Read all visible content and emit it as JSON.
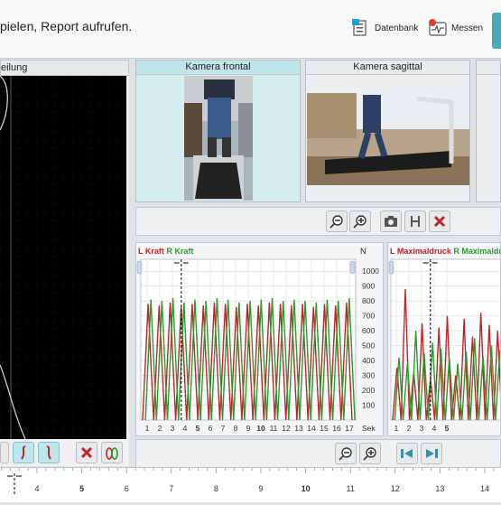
{
  "header": {
    "instruction": "pielen, Report aufrufen.",
    "datenbank_label": "Datenbank",
    "messen_label": "Messen"
  },
  "left_panel": {
    "title": "eilung"
  },
  "cameras": [
    {
      "title": "Kamera frontal",
      "selected": true
    },
    {
      "title": "Kamera sagittal",
      "selected": false
    }
  ],
  "chart_data": [
    {
      "type": "line",
      "title": "",
      "legend": [
        "L Kraft",
        "R Kraft"
      ],
      "series": [
        {
          "name": "L Kraft",
          "color": "#c0232a",
          "values": [
            0,
            780,
            0,
            770,
            0,
            790,
            0,
            760,
            0,
            780,
            0,
            770,
            0,
            790,
            0,
            780,
            0,
            760,
            0,
            780,
            0,
            770,
            0,
            790,
            0,
            780,
            0,
            770,
            0,
            780,
            0,
            760,
            0,
            780,
            0,
            770,
            0,
            790,
            0
          ]
        },
        {
          "name": "R Kraft",
          "color": "#2a9a2a",
          "values": [
            0,
            810,
            0,
            800,
            0,
            820,
            0,
            790,
            0,
            810,
            0,
            800,
            0,
            820,
            0,
            810,
            0,
            790,
            0,
            800,
            0,
            810,
            0,
            820,
            0,
            800,
            0,
            810,
            0,
            800,
            0,
            790,
            0,
            810,
            0,
            800,
            0,
            820,
            0
          ]
        }
      ],
      "x_ticks": [
        "1",
        "2",
        "3",
        "4",
        "5",
        "6",
        "7",
        "8",
        "9",
        "10",
        "11",
        "12",
        "13",
        "14",
        "15",
        "16",
        "17"
      ],
      "x_unit": "Sek",
      "y_ticks": [
        "100",
        "200",
        "300",
        "400",
        "500",
        "600",
        "700",
        "800",
        "900",
        "1000"
      ],
      "y_unit": "N",
      "ylim": [
        0,
        1080
      ],
      "xlim": [
        0.5,
        17.5
      ],
      "cursor_x": 3.7
    },
    {
      "type": "line",
      "title": "",
      "legend": [
        "L Maximaldruck",
        "R Maximaldruck"
      ],
      "series": [
        {
          "name": "L Maximaldruck",
          "color": "#c0232a",
          "values": [
            0,
            350,
            0,
            880,
            0,
            320,
            0,
            650,
            0,
            280,
            0,
            620,
            0,
            700,
            0,
            300,
            0,
            680,
            0,
            560,
            0,
            720,
            0,
            640,
            0,
            600,
            0
          ]
        },
        {
          "name": "R Maximaldruck",
          "color": "#2a9a2a",
          "values": [
            0,
            420,
            0,
            380,
            0,
            600,
            0,
            450,
            0,
            520,
            0,
            480,
            0,
            420,
            0,
            380,
            0,
            460,
            0,
            550,
            0,
            430,
            0,
            500,
            0,
            470,
            0
          ]
        }
      ],
      "x_ticks": [
        "1",
        "2",
        "3",
        "4",
        "5"
      ],
      "cursor_x": 3.7
    }
  ],
  "timeline": {
    "ticks": [
      "4",
      "5",
      "6",
      "7",
      "8",
      "9",
      "10",
      "11",
      "12",
      "13",
      "14"
    ],
    "bold_ticks": [
      "5",
      "10"
    ]
  }
}
